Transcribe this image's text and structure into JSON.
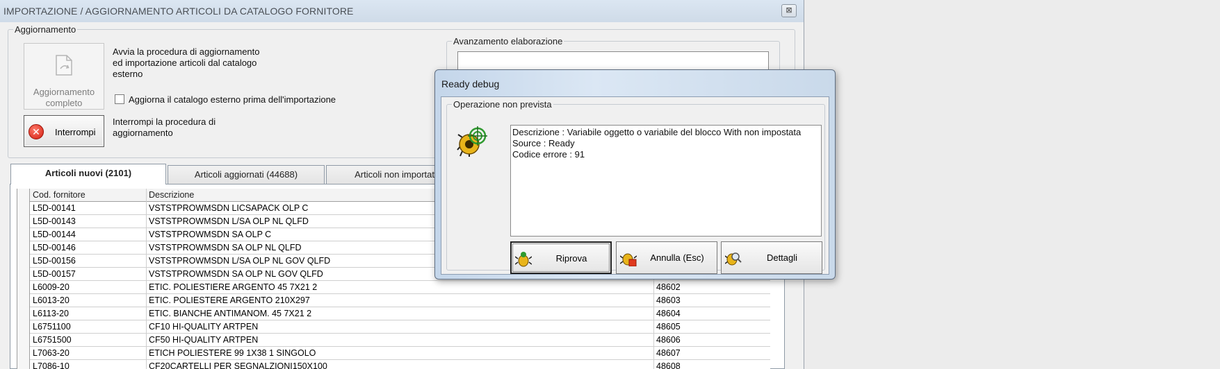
{
  "window": {
    "title": "IMPORTAZIONE / AGGIORNAMENTO ARTICOLI DA CATALOGO FORNITORE",
    "close_label": "⊠"
  },
  "update_group": {
    "legend": "Aggiornamento",
    "full_update_label_1": "Aggiornamento",
    "full_update_label_2": "completo",
    "full_update_desc_1": "Avvia la procedura di aggiornamento",
    "full_update_desc_2": "ed importazione articoli dal catalogo",
    "full_update_desc_3": "esterno",
    "refresh_checkbox_label": "Aggiorna il catalogo esterno prima dell'importazione",
    "refresh_checked": false,
    "stop_label": "Interrompi",
    "stop_desc_1": "Interrompi la procedura di",
    "stop_desc_2": "aggiornamento"
  },
  "progress": {
    "legend": "Avanzamento elaborazione"
  },
  "tabs": [
    {
      "label": "Articoli nuovi (2101)",
      "active": true
    },
    {
      "label": "Articoli aggiornati (44688)",
      "active": false
    },
    {
      "label": "Articoli non importati",
      "active": false
    }
  ],
  "table": {
    "columns": [
      "Cod. fornitore",
      "Descrizione",
      ""
    ],
    "rows": [
      [
        "L5D-00141",
        "VSTSTPROWMSDN LICSAPACK OLP C",
        ""
      ],
      [
        "L5D-00143",
        "VSTSTPROWMSDN L/SA OLP NL QLFD",
        ""
      ],
      [
        "L5D-00144",
        "VSTSTPROWMSDN SA OLP C",
        ""
      ],
      [
        "L5D-00146",
        "VSTSTPROWMSDN SA OLP NL QLFD",
        ""
      ],
      [
        "L5D-00156",
        "VSTSTPROWMSDN L/SA OLP NL GOV QLFD",
        ""
      ],
      [
        "L5D-00157",
        "VSTSTPROWMSDN SA OLP NL GOV QLFD",
        ""
      ],
      [
        "L6009-20",
        "ETIC. POLIESTIERE ARGENTO 45 7X21 2",
        "48602"
      ],
      [
        "L6013-20",
        "ETIC. POLIESTERE ARGENTO 210X297",
        "48603"
      ],
      [
        "L6113-20",
        "ETIC. BIANCHE ANTIMANOM. 45 7X21 2",
        "48604"
      ],
      [
        "L6751100",
        "CF10 HI-QUALITY ARTPEN",
        "48605"
      ],
      [
        "L6751500",
        "CF50 HI-QUALITY ARTPEN",
        "48606"
      ],
      [
        "L7063-20",
        "ETICH POLIESTERE 99 1X38 1  SINGOLO",
        "48607"
      ],
      [
        "L7086-10",
        "CF20CARTELLI PER SEGNALZIONI150X100",
        "48608"
      ]
    ]
  },
  "dialog": {
    "title": "Ready debug",
    "group_legend": "Operazione non prevista",
    "message_lines": [
      "Descrizione : Variabile oggetto o variabile del blocco With non impostata",
      "Source : Ready",
      "Codice errore : 91"
    ],
    "buttons": [
      {
        "label": "Riprova",
        "focused": true
      },
      {
        "label": "Annulla (Esc)",
        "focused": false
      },
      {
        "label": "Dettagli",
        "focused": false
      }
    ]
  }
}
